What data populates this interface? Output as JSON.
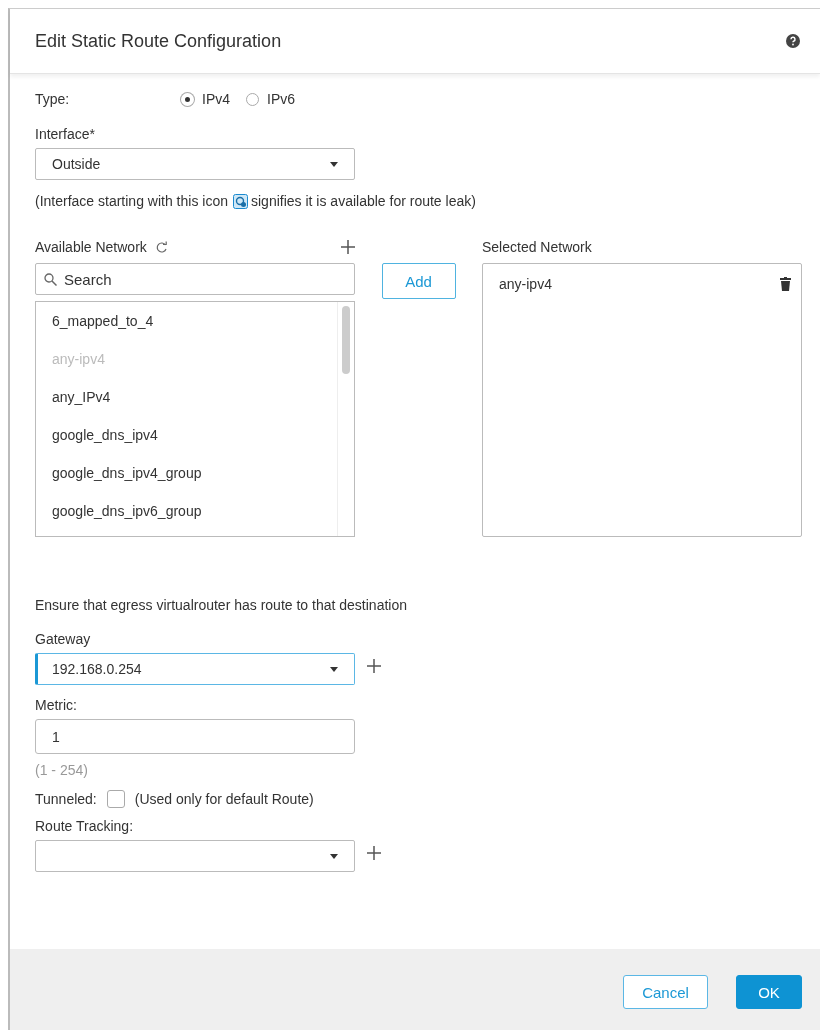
{
  "dialog": {
    "title": "Edit Static Route Configuration"
  },
  "type": {
    "label": "Type:",
    "options": [
      {
        "label": "IPv4",
        "selected": true
      },
      {
        "label": "IPv6",
        "selected": false
      }
    ]
  },
  "interface": {
    "label": "Interface*",
    "value": "Outside"
  },
  "note": {
    "before": "(Interface starting with this icon",
    "after": "signifies it is available for route leak)"
  },
  "available_network": {
    "label": "Available Network",
    "search": {
      "placeholder": "Search"
    },
    "add_button": "Add",
    "items": [
      {
        "label": "6_mapped_to_4",
        "disabled": false
      },
      {
        "label": "any-ipv4",
        "disabled": true
      },
      {
        "label": "any_IPv4",
        "disabled": false
      },
      {
        "label": "google_dns_ipv4",
        "disabled": false
      },
      {
        "label": "google_dns_ipv4_group",
        "disabled": false
      },
      {
        "label": "google_dns_ipv6_group",
        "disabled": false
      }
    ]
  },
  "selected_network": {
    "label": "Selected Network",
    "items": [
      "any-ipv4"
    ]
  },
  "ensure_note": "Ensure that egress virtualrouter has route to that destination",
  "gateway": {
    "label": "Gateway",
    "value": "192.168.0.254"
  },
  "metric": {
    "label": "Metric:",
    "value": "1",
    "range": "(1 - 254)"
  },
  "tunneled": {
    "label": "Tunneled:",
    "checked": false,
    "hint": "(Used only for default Route)"
  },
  "route_tracking": {
    "label": "Route Tracking:"
  },
  "buttons": [
    {
      "label": "Cancel",
      "kind": "secondary"
    },
    {
      "label": "OK",
      "kind": "primary"
    }
  ]
}
